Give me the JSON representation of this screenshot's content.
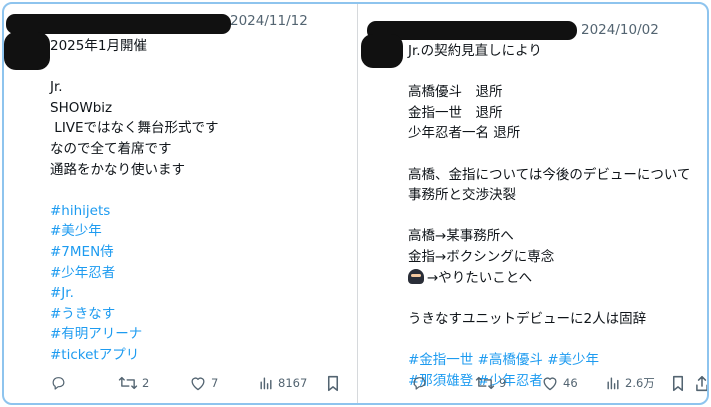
{
  "left_tweet": {
    "date": "2024/11/12",
    "lines": [
      {
        "text": "2025年1月開催",
        "hashtag": false
      },
      {
        "text": "",
        "hashtag": false
      },
      {
        "text": "Jr.",
        "hashtag": false
      },
      {
        "text": "SHOWbiz",
        "hashtag": false
      },
      {
        "text": " LIVEではなく舞台形式です",
        "hashtag": false
      },
      {
        "text": "なので全て着席です",
        "hashtag": false
      },
      {
        "text": "通路をかなり使います",
        "hashtag": false
      },
      {
        "text": "",
        "hashtag": false
      },
      {
        "text": "#hihijets",
        "hashtag": true
      },
      {
        "text": "#美少年",
        "hashtag": true
      },
      {
        "text": "#7MEN侍",
        "hashtag": true
      },
      {
        "text": "#少年忍者",
        "hashtag": true
      },
      {
        "text": "#Jr.",
        "hashtag": true
      },
      {
        "text": "#うきなす",
        "hashtag": true
      },
      {
        "text": "#有明アリーナ",
        "hashtag": true
      },
      {
        "text": "#ticketアプリ",
        "hashtag": true
      }
    ],
    "actions": {
      "reply": "",
      "retweet": "2",
      "like": "7",
      "views": "8167"
    }
  },
  "right_tweet": {
    "date": "2024/10/02",
    "lines": [
      {
        "text": "Jr.の契約見直しにより",
        "hashtag": false
      },
      {
        "text": "",
        "hashtag": false
      },
      {
        "text": "高橋優斗　退所",
        "hashtag": false
      },
      {
        "text": "金指一世　退所",
        "hashtag": false
      },
      {
        "text": "少年忍者一名 退所",
        "hashtag": false
      },
      {
        "text": "",
        "hashtag": false
      },
      {
        "text": "高橋、金指については今後のデビューについて",
        "hashtag": false
      },
      {
        "text": "事務所と交渉決裂",
        "hashtag": false
      },
      {
        "text": "",
        "hashtag": false
      },
      {
        "text": "高橋→某事務所へ",
        "hashtag": false
      },
      {
        "text": "金指→ボクシングに専念",
        "hashtag": false
      },
      {
        "text": "→やりたいことへ",
        "hashtag": false,
        "emoji": "ninja-emoji"
      },
      {
        "text": "",
        "hashtag": false
      },
      {
        "text": "うきなすユニットデビューに2人は固辞",
        "hashtag": false
      },
      {
        "text": "",
        "hashtag": false
      },
      {
        "text": "#金指一世 #高橋優斗 #美少年",
        "hashtag": true
      },
      {
        "text": "#那須雄登 #少年忍者",
        "hashtag": true
      }
    ],
    "actions": {
      "reply": "",
      "retweet": "9",
      "like": "46",
      "views": "2.6万"
    }
  },
  "icons": [
    "reply-icon",
    "retweet-icon",
    "like-icon",
    "views-icon",
    "bookmark-icon",
    "share-icon"
  ],
  "colors": {
    "accent": "#1d9bf0",
    "text": "#0f1419",
    "muted": "#536471",
    "border": "#8ec4ee"
  }
}
